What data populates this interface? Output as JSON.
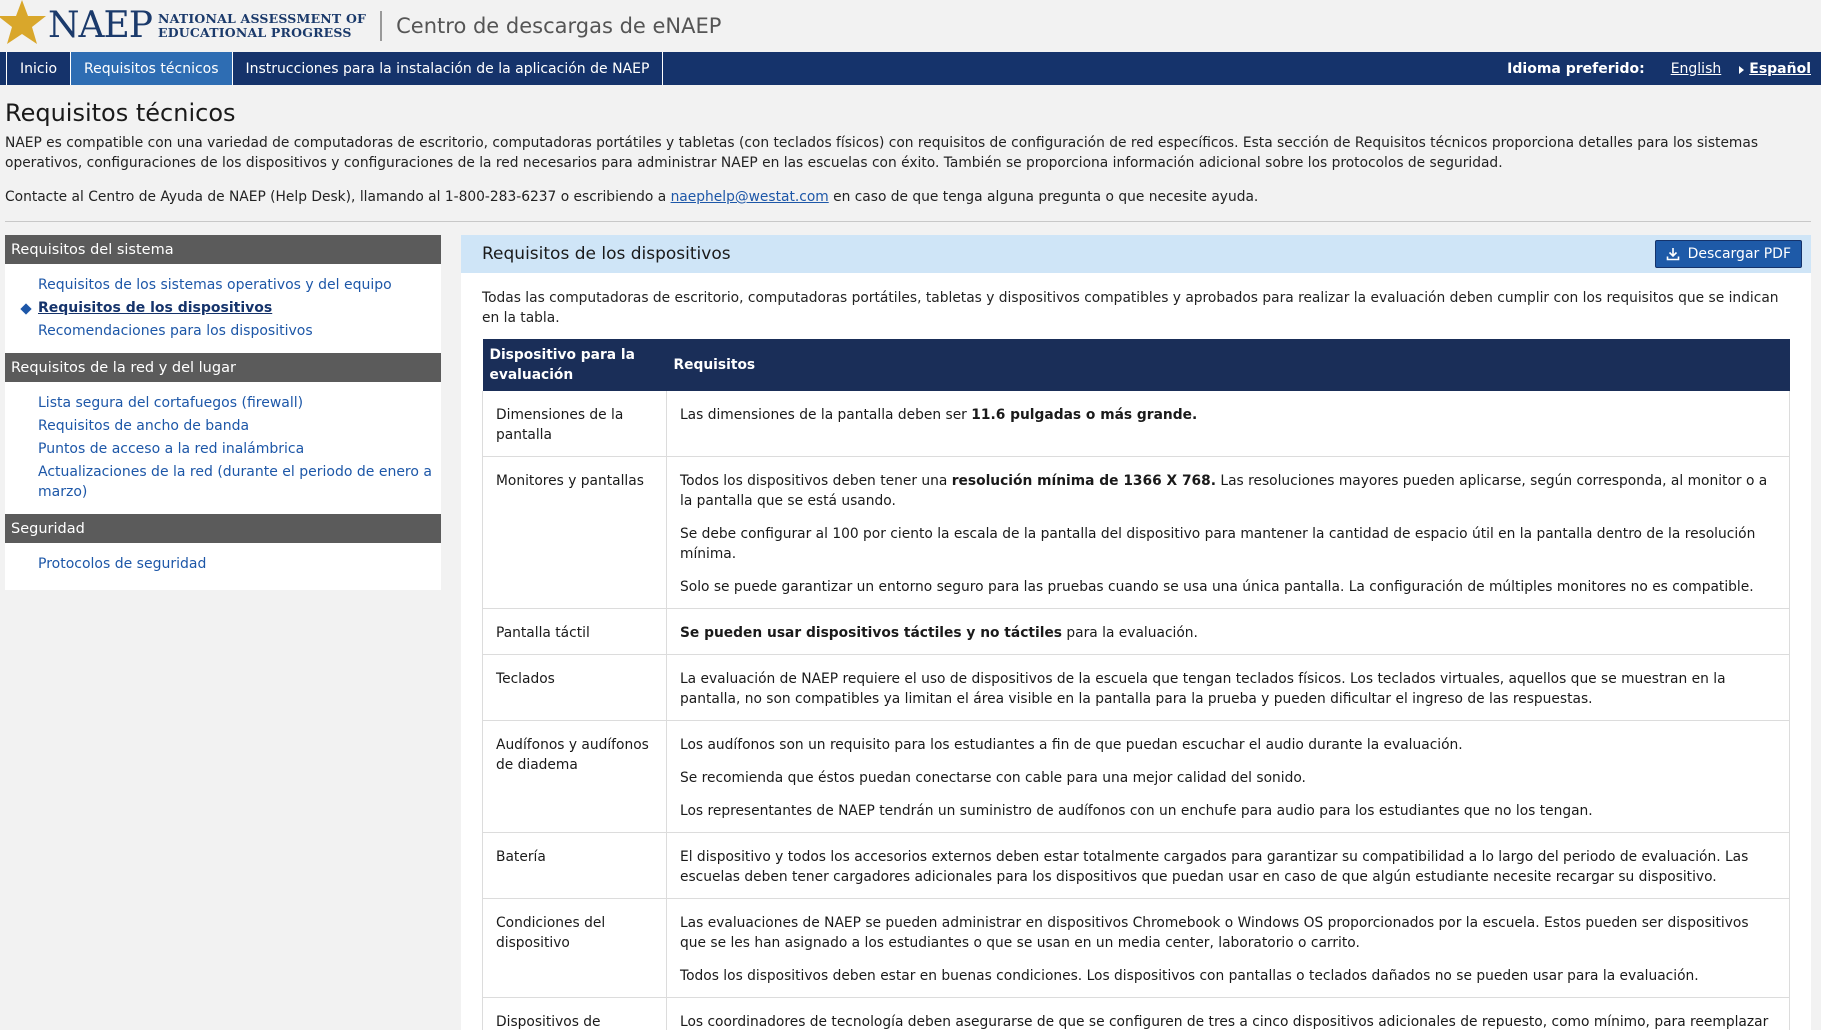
{
  "header": {
    "logo_text": "NAEP",
    "logo_subtitle_line1": "NATIONAL ASSESSMENT OF",
    "logo_subtitle_line2": "EDUCATIONAL PROGRESS",
    "site_title": "Centro de descargas de eNAEP"
  },
  "nav": {
    "items": [
      {
        "label": "Inicio"
      },
      {
        "label": "Requisitos técnicos"
      },
      {
        "label": "Instrucciones para la instalación de la aplicación de NAEP"
      }
    ],
    "language_label": "Idioma preferido:",
    "language_english": "English",
    "language_spanish": "Español"
  },
  "intro": {
    "title": "Requisitos técnicos",
    "paragraph": "NAEP es compatible con una variedad de computadoras de escritorio, computadoras portátiles y tabletas (con teclados físicos) con requisitos de configuración de red específicos. Esta sección de Requisitos técnicos proporciona detalles para los sistemas operativos, configuraciones de los dispositivos y configuraciones de la red necesarios para administrar NAEP en las escuelas con éxito. También se proporciona información adicional sobre los protocolos de seguridad.",
    "contact_before": "Contacte al Centro de Ayuda de NAEP (Help Desk), llamando al 1-800-283-6237 o escribiendo a ",
    "contact_email": "naephelp@westat.com",
    "contact_after": " en caso de que tenga alguna pregunta o que necesite ayuda."
  },
  "sidebar": {
    "sections": [
      {
        "heading": "Requisitos del sistema",
        "items": [
          "Requisitos de los sistemas operativos y del equipo",
          "Requisitos de los dispositivos",
          "Recomendaciones para los dispositivos"
        ]
      },
      {
        "heading": "Requisitos de la red y del lugar",
        "items": [
          "Lista segura del cortafuegos (firewall)",
          "Requisitos de ancho de banda",
          "Puntos de acceso a la red inalámbrica",
          "Actualizaciones de la red (durante el periodo de enero a marzo)"
        ]
      },
      {
        "heading": "Seguridad",
        "items": [
          "Protocolos de seguridad"
        ]
      }
    ]
  },
  "main": {
    "title": "Requisitos de los dispositivos",
    "pdf_button": "Descargar PDF",
    "description": "Todas las computadoras de escritorio, computadoras portátiles, tabletas y dispositivos compatibles y aprobados para realizar la evaluación deben cumplir con los requisitos que se indican en la tabla.",
    "table": {
      "col1": "Dispositivo para la evaluación",
      "col2": "Requisitos",
      "rows": [
        {
          "device": "Dimensiones de la pantalla",
          "r1_before": "Las dimensiones de la pantalla deben ser ",
          "r1_bold": "11.6 pulgadas o más grande."
        },
        {
          "device": "Monitores y pantallas",
          "r1_before": "Todos los dispositivos deben tener una ",
          "r1_bold": "resolución mínima de 1366 X 768.",
          "r1_after": " Las resoluciones mayores pueden aplicarse, según corresponda, al monitor o a la pantalla que se está usando.",
          "r2": "Se debe configurar al 100 por ciento la escala de la pantalla del dispositivo para mantener la cantidad de espacio útil en la pantalla dentro de la resolución mínima.",
          "r3": "Solo se puede garantizar un entorno seguro para las pruebas cuando se usa una única pantalla. La configuración de múltiples monitores no es compatible."
        },
        {
          "device": "Pantalla táctil",
          "r1_bold": "Se pueden usar dispositivos táctiles y no táctiles",
          "r1_after": " para la evaluación."
        },
        {
          "device": "Teclados",
          "r1": "La evaluación de NAEP requiere el uso de dispositivos de la escuela que tengan teclados físicos. Los teclados virtuales, aquellos que se muestran en la pantalla, no son compatibles ya limitan el área visible en la pantalla para la prueba y pueden dificultar el ingreso de las respuestas."
        },
        {
          "device": "Audífonos y audífonos de diadema",
          "r1": "Los audífonos son un requisito para los estudiantes a fin de que puedan escuchar el audio durante la evaluación.",
          "r2": "Se recomienda que éstos puedan conectarse con cable para una mejor calidad del sonido.",
          "r3": "Los representantes de NAEP tendrán un suministro de audífonos con un enchufe para audio para los estudiantes que no los tengan."
        },
        {
          "device": "Batería",
          "r1": "El dispositivo y todos los accesorios externos deben estar totalmente cargados para garantizar su compatibilidad a lo largo del periodo de evaluación. Las escuelas deben tener cargadores adicionales para los dispositivos que puedan usar en caso de que algún estudiante necesite recargar su dispositivo."
        },
        {
          "device": "Condiciones del dispositivo",
          "r1": "Las evaluaciones de NAEP se pueden administrar en dispositivos Chromebook o Windows OS proporcionados por la escuela. Estos pueden ser dispositivos que se les han asignado a los estudiantes o que se usan en un media center, laboratorio o carrito.",
          "r2": "Todos los dispositivos deben estar en buenas condiciones. Los dispositivos con pantallas o teclados dañados no se pueden usar para la evaluación."
        },
        {
          "device": "Dispositivos de repuesto",
          "r1": "Los coordinadores de tecnología deben asegurarse de que se configuren de tres a cinco dispositivos adicionales de repuesto, como mínimo, para reemplazar aquellos que se olvidaron o que tengan problemas el día de la evaluación."
        }
      ]
    }
  },
  "colors": {
    "nav_bg": "#15336b",
    "nav_active": "#2e6db3",
    "table_header": "#1a2e58",
    "link": "#1d57a8",
    "panel_header": "#cfe5f7"
  }
}
